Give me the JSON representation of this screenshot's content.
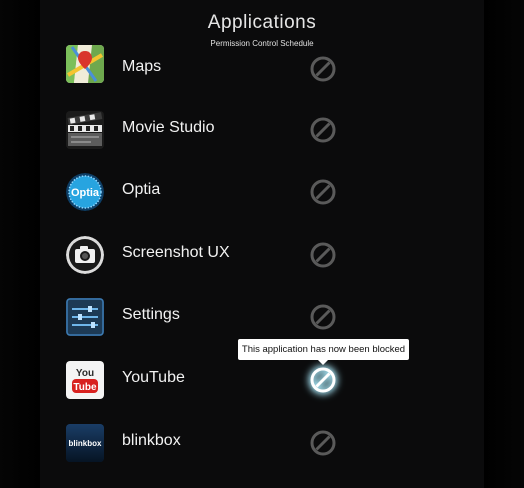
{
  "header": {
    "title": "Applications",
    "subtitle": "Permission Control Schedule"
  },
  "apps": [
    {
      "label": "Maps",
      "icon": "maps-icon",
      "blocked": false
    },
    {
      "label": "Movie Studio",
      "icon": "movie-studio-icon",
      "blocked": false
    },
    {
      "label": "Optia",
      "icon": "optia-icon",
      "icon_text": "Optia",
      "blocked": false
    },
    {
      "label": "Screenshot UX",
      "icon": "screenshot-camera-icon",
      "blocked": false
    },
    {
      "label": "Settings",
      "icon": "settings-sliders-icon",
      "blocked": false
    },
    {
      "label": "YouTube",
      "icon": "youtube-icon",
      "icon_text_top": "You",
      "icon_text_bottom": "Tube",
      "blocked": true
    },
    {
      "label": "blinkbox",
      "icon": "blinkbox-icon",
      "icon_text": "blinkbox",
      "blocked": false
    }
  ],
  "tooltip": {
    "text": "This application has now been blocked"
  },
  "colors": {
    "background": "#000000",
    "panel": "#0b0b0c",
    "block_inactive": "#5a5a5a",
    "block_active_glow": "#bff5ff",
    "tooltip_bg": "#ffffff"
  }
}
